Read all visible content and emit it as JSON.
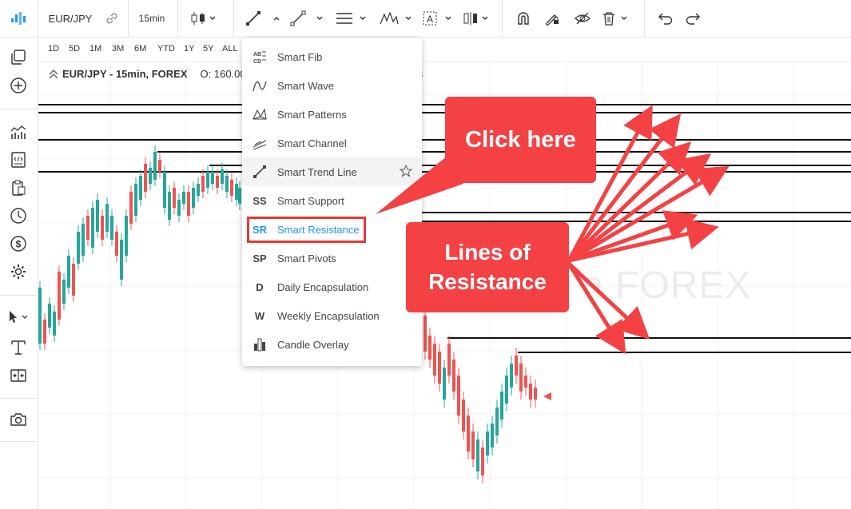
{
  "toolbar": {
    "symbol": "EUR/JPY",
    "interval": "15min"
  },
  "ranges": [
    "1D",
    "5D",
    "1M",
    "3M",
    "6M",
    "YTD",
    "1Y",
    "5Y",
    "ALL"
  ],
  "legend": {
    "title": "EUR/JPY - 15min, FOREX",
    "ohlc": "O: 160.00",
    "tail": "3"
  },
  "watermark": "n FOREX",
  "menu": {
    "items": [
      {
        "icon": "abcd",
        "label": "Smart Fib"
      },
      {
        "icon": "wave",
        "label": "Smart Wave"
      },
      {
        "icon": "patterns",
        "label": "Smart Patterns"
      },
      {
        "icon": "channel",
        "label": "Smart Channel"
      },
      {
        "icon": "trend-line",
        "label": "Smart Trend Line"
      },
      {
        "icon": "SS",
        "label": "Smart Support"
      },
      {
        "icon": "SR",
        "label": "Smart Resistance"
      },
      {
        "icon": "SP",
        "label": "Smart Pivots"
      },
      {
        "icon": "D",
        "label": "Daily Encapsulation"
      },
      {
        "icon": "W",
        "label": "Weekly Encapsulation"
      },
      {
        "icon": "candle",
        "label": "Candle Overlay"
      }
    ],
    "active_color": "#2196f3"
  },
  "callouts": {
    "click_here": "Click here",
    "lines_line1": "Lines of",
    "lines_line2": "Resistance"
  },
  "colors": {
    "bull": "#26a69a",
    "bear": "#ef5350",
    "callout": "#f44144",
    "accent": "#2196f3"
  }
}
